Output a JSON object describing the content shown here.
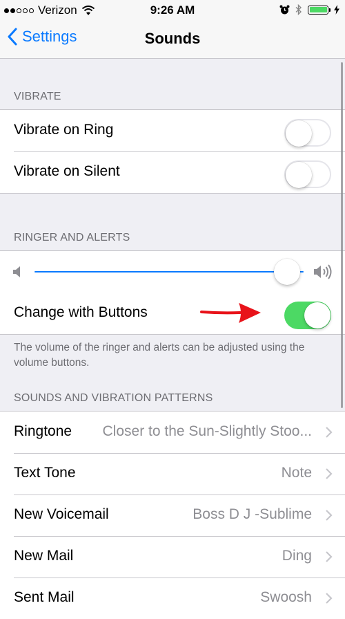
{
  "status_bar": {
    "carrier": "Verizon",
    "time": "9:26 AM",
    "signal_bars": 2,
    "battery_level": 1.0,
    "icons": [
      "wifi-icon",
      "alarm-icon",
      "bluetooth-icon",
      "battery-icon",
      "charging-icon"
    ]
  },
  "nav": {
    "back_label": "Settings",
    "title": "Sounds"
  },
  "vibrate": {
    "header": "VIBRATE",
    "items": [
      {
        "label": "Vibrate on Ring",
        "on": false
      },
      {
        "label": "Vibrate on Silent",
        "on": false
      }
    ]
  },
  "ringer": {
    "header": "RINGER AND ALERTS",
    "volume_level": 0.95,
    "change_with_buttons_label": "Change with Buttons",
    "change_with_buttons_on": true,
    "footer": "The volume of the ringer and alerts can be adjusted using the volume buttons."
  },
  "patterns": {
    "header": "SOUNDS AND VIBRATION PATTERNS",
    "items": [
      {
        "label": "Ringtone",
        "value": "Closer to the Sun-Slightly Stoo..."
      },
      {
        "label": "Text Tone",
        "value": "Note"
      },
      {
        "label": "New Voicemail",
        "value": "Boss D J -Sublime"
      },
      {
        "label": "New Mail",
        "value": "Ding"
      },
      {
        "label": "Sent Mail",
        "value": "Swoosh"
      }
    ]
  },
  "colors": {
    "accent": "#0a7aff",
    "switch_on": "#4cd964",
    "background": "#efeff4",
    "annotation_arrow": "#e8131a"
  }
}
